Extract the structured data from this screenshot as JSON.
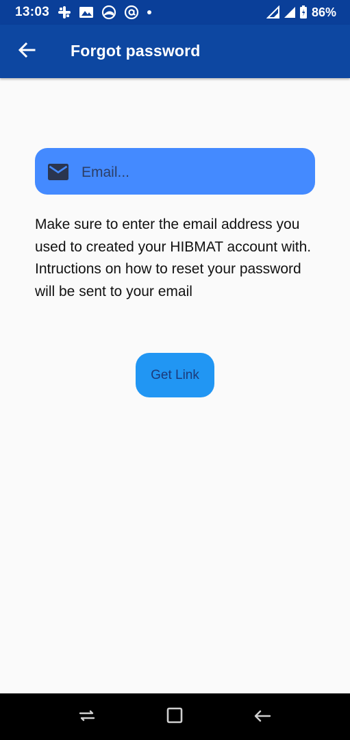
{
  "status_bar": {
    "time": "13:03",
    "notification_icons": [
      "slack-icon",
      "image-icon",
      "browser-icon",
      "at-sign-icon",
      "dot-icon"
    ],
    "battery_percent": "86%"
  },
  "app_bar": {
    "title": "Forgot password",
    "back_icon": "arrow-left-icon"
  },
  "email_field": {
    "icon": "mail-icon",
    "placeholder": "Email...",
    "value": ""
  },
  "instructions": {
    "line1": "Make sure to enter the email address you used to created your HIBMAT account with.",
    "line2": "Intructions on how to reset your password will be sent to your email"
  },
  "get_link_button": {
    "label": "Get Link"
  },
  "colors": {
    "status_bar": "#0a3f99",
    "app_bar": "#0d47a1",
    "email_field": "#448aff",
    "button": "#2196f3",
    "background": "#fafafa"
  }
}
